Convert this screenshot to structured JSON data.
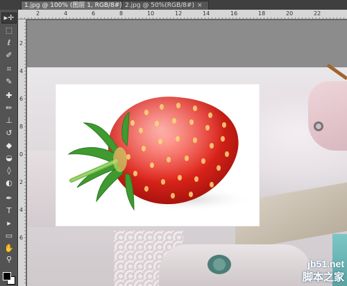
{
  "tabs": [
    {
      "label": "1.jpg @ 100% (图层 1, RGB/8#) *",
      "close": "×",
      "active": true
    },
    {
      "label": "2.jpg @ 50%(RGB/8#)",
      "close": "×",
      "active": false
    }
  ],
  "ruler_top_labels": [
    "2",
    "4",
    "6",
    "8",
    "10",
    "12",
    "14",
    "16",
    "18",
    "20",
    "22"
  ],
  "ruler_left_labels": [
    "2",
    "4",
    "6",
    "8",
    "0",
    "2",
    "4",
    "6"
  ],
  "tools": [
    {
      "icon": "move-icon",
      "glyph": "▸✛"
    },
    {
      "icon": "marquee-icon",
      "glyph": "⬚"
    },
    {
      "icon": "lasso-icon",
      "glyph": "ℓ"
    },
    {
      "icon": "quick-select-icon",
      "glyph": "✐"
    },
    {
      "icon": "crop-icon",
      "glyph": "⌗"
    },
    {
      "icon": "eyedropper-icon",
      "glyph": "✎"
    },
    {
      "icon": "healing-brush-icon",
      "glyph": "✚"
    },
    {
      "icon": "brush-icon",
      "glyph": "✏"
    },
    {
      "icon": "clone-stamp-icon",
      "glyph": "⊥"
    },
    {
      "icon": "history-brush-icon",
      "glyph": "↺"
    },
    {
      "icon": "eraser-icon",
      "glyph": "◆"
    },
    {
      "icon": "paint-bucket-icon",
      "glyph": "◒"
    },
    {
      "icon": "blur-icon",
      "glyph": "◊"
    },
    {
      "icon": "dodge-icon",
      "glyph": "◐"
    },
    {
      "icon": "pen-icon",
      "glyph": "✒"
    },
    {
      "icon": "type-icon",
      "glyph": "T"
    },
    {
      "icon": "path-select-icon",
      "glyph": "▸"
    },
    {
      "icon": "shape-icon",
      "glyph": "▭"
    },
    {
      "icon": "hand-icon",
      "glyph": "✋"
    },
    {
      "icon": "zoom-icon",
      "glyph": "⚲"
    }
  ],
  "watermark": {
    "url": "jb51.net",
    "cn": "脚本之家"
  },
  "colors": {
    "foreground": "#000000",
    "background": "#ffffff"
  }
}
